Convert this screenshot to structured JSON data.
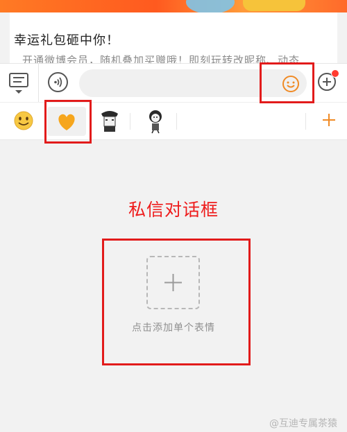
{
  "card": {
    "title": "幸运礼包砸中你！",
    "description": "开通微博会员，随机叠加买赠哦！即刻玩转改昵称、动态"
  },
  "input": {
    "placeholder": ""
  },
  "annotation": {
    "label": "私信对话框"
  },
  "sticker_panel": {
    "add_hint": "点击添加单个表情"
  },
  "watermark": {
    "text": "@互迪专属茶猿"
  },
  "emoji_categories": [
    "smiley-emoji",
    "heart-emoji",
    "officer-sticker",
    "character-sticker"
  ],
  "colors": {
    "accent": "#f08a24",
    "annotation_red": "#e21b1b",
    "notification_dot": "#ff3b30"
  }
}
